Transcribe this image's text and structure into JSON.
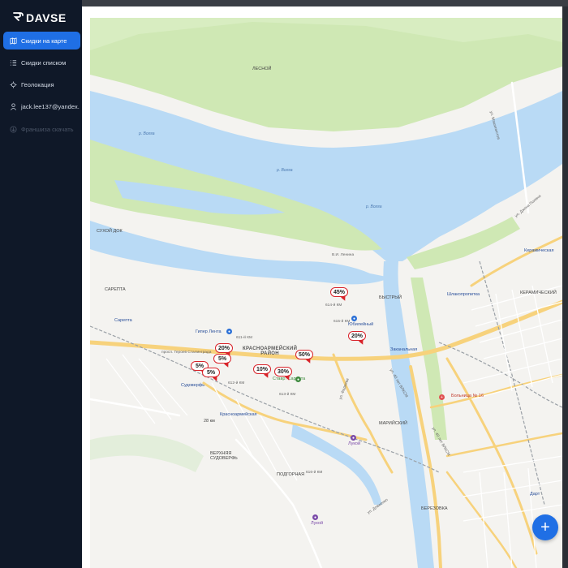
{
  "app": {
    "logo_text": "DAVSE",
    "logo_icon": "rr-logo-icon"
  },
  "sidebar": {
    "items": [
      {
        "label": "Скидки на карте",
        "icon": "map-icon",
        "active": true
      },
      {
        "label": "Скидки списком",
        "icon": "list-icon",
        "active": false
      },
      {
        "label": "Геолокация",
        "icon": "geolocation-icon",
        "active": false
      },
      {
        "label": "jack.lee137@yandex.",
        "icon": "user-icon",
        "active": false
      },
      {
        "label": "Франшиза скачать",
        "icon": "download-icon",
        "active": false,
        "disabled": true
      }
    ]
  },
  "map": {
    "discount_pins": [
      "45%",
      "20%",
      "20%",
      "5%",
      "5%",
      "5%",
      "10%",
      "30%",
      "50%"
    ],
    "district_label": "КРАСНОАРМЕЙСКИЙ\nРАЙОН",
    "labels": {
      "lesnoy": "ЛЕСНОЙ",
      "volga1": "р. Волга",
      "volga2": "р. Волга",
      "volga3": "р. Волга",
      "sukhoy_dok": "СУХОЙ ДОК",
      "sarepta_top": "САРЕПТА",
      "sarepta_poi": "Сарепта",
      "giper_lenta": "Гипер Лента",
      "prosp_geroev": "просп. Героев Сталинграда",
      "sudoverf": "Судоверфь",
      "krasnoarmeysk": "Красноармейская",
      "km28": "28 км",
      "verkhnyaya": "ВЕРХНЯЯ\nСУДОВЕРФЬ",
      "podgornaya": "ПОДГОРНАЯ",
      "stavr": "Ставр. Сарепта",
      "luchik_bottom": "Лукой",
      "luchik_mid": "Лукой",
      "yubileyny": "Юбилейный",
      "zakanalnaya": "Заканальная",
      "shlakopr": "Шлакопропитка",
      "bolnitsa": "Больница № 16",
      "keramicheskaya": "Керамическая",
      "keramicheskiy": "КЕРАМИЧЕСКИЙ",
      "bystry": "БЫСТРЫЙ",
      "mariinsky": "МАРИЙСКИЙ",
      "berezovka": "БЕРЕЗОВКА",
      "dart": "Дарт",
      "ul_fadeeva": "ул. Фадеева",
      "ul_doveenko": "ул. Довженко",
      "ul_40let": "ул. 40 лет ВЛКСМ",
      "ul_40let_2": "ул. 40 лет ВЛКСМ",
      "vi_lenina": "В.И. Ленина",
      "ul_dzhe": "ул. Джона Поляна",
      "ul_mashki": "ул. Машинистов",
      "k611": "611-й КМ",
      "k612": "612-й КМ",
      "k613": "613-й КМ",
      "k614": "614-й КМ",
      "k615": "615-й КМ",
      "k616": "616-й КМ"
    },
    "colors": {
      "water": "#b9daf5",
      "land": "#f4f3f0",
      "park": "#cfe8b4",
      "road": "#f7d27c",
      "rail": "#9aa0a6",
      "pin": "#d8232a"
    }
  },
  "fab": {
    "label": "+"
  }
}
